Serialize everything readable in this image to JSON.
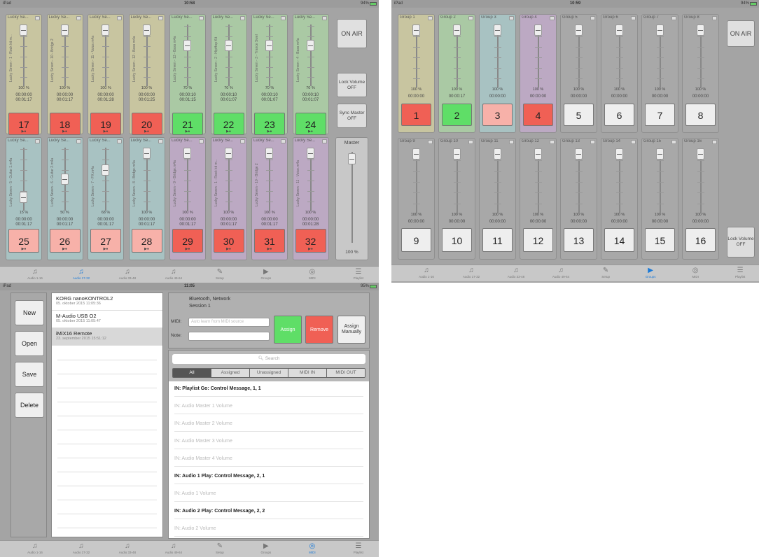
{
  "screen1": {
    "status": {
      "device": "iPad",
      "time": "10:58",
      "battery": "94%"
    },
    "row1": [
      {
        "name": "Lucky Se...",
        "track": "Lucky Seven - 1 - Rock kit m...",
        "color": "y",
        "pct": "100 %",
        "t1": "00:00:00",
        "t2": "00:01:17",
        "num": "17",
        "pad": "red"
      },
      {
        "name": "Lucky Se...",
        "track": "Lucky Seven - 10 - Bridge 2",
        "color": "y",
        "pct": "100 %",
        "t1": "00:00:00",
        "t2": "00:01:17",
        "num": "18",
        "pad": "red"
      },
      {
        "name": "Lucky Se...",
        "track": "Lucky Seven - 11 - Voice.m4a",
        "color": "y",
        "pct": "100 %",
        "t1": "00:00:00",
        "t2": "00:01:28",
        "num": "19",
        "pad": "red"
      },
      {
        "name": "Lucky Se...",
        "track": "Lucky Seven - 12 - Bass m4a",
        "color": "y",
        "pct": "100 %",
        "t1": "00:00:00",
        "t2": "00:01:25",
        "num": "20",
        "pad": "red"
      },
      {
        "name": "Lucky Se...",
        "track": "Lucky Seven - 13 - Bass m4a",
        "color": "g",
        "pct": "70 %",
        "t1": "00:00:10",
        "t2": "00:01:15",
        "num": "21",
        "pad": "grn"
      },
      {
        "name": "Lucky Se...",
        "track": "Lucky Seven - 2 - HipHop Kit",
        "color": "g",
        "pct": "70 %",
        "t1": "00:00:10",
        "t2": "00:01:07",
        "num": "22",
        "pad": "grn"
      },
      {
        "name": "Lucky Se...",
        "track": "Lucky Seven - 3 - Trance Swel",
        "color": "g",
        "pct": "70 %",
        "t1": "00:00:10",
        "t2": "00:01:07",
        "num": "23",
        "pad": "grn"
      },
      {
        "name": "Lucky Se...",
        "track": "Lucky Seven - 4 - Bass m4a",
        "color": "g",
        "pct": "70 %",
        "t1": "00:00:10",
        "t2": "00:01:07",
        "num": "24",
        "pad": "grn"
      }
    ],
    "row2": [
      {
        "name": "Lucky Se...",
        "track": "Lucky Seven - 5 - Guitar 1.m4a",
        "color": "t",
        "pct": "15 %",
        "t1": "00:00:00",
        "t2": "00:01:17",
        "num": "25",
        "pad": "pink"
      },
      {
        "name": "Lucky Se...",
        "track": "Lucky Seven - 6 - Guitar 2.m4a",
        "color": "t",
        "pct": "50 %",
        "t1": "00:00:00",
        "t2": "00:01:17",
        "num": "26",
        "pad": "pink"
      },
      {
        "name": "Lucky Se...",
        "track": "Lucky Seven - 7 - FX.m4a",
        "color": "t",
        "pct": "68 %",
        "t1": "00:00:00",
        "t2": "00:01:17",
        "num": "27",
        "pad": "pink"
      },
      {
        "name": "Lucky Se...",
        "track": "Lucky Seven - 8 - Bridge.m4a",
        "color": "t",
        "pct": "100 %",
        "t1": "00:00:00",
        "t2": "00:01:17",
        "num": "28",
        "pad": "pink"
      },
      {
        "name": "Lucky Se...",
        "track": "Lucky Seven - 9 - Bridge.m4a",
        "color": "p",
        "pct": "100 %",
        "t1": "00:00:00",
        "t2": "00:01:17",
        "num": "29",
        "pad": "red"
      },
      {
        "name": "Lucky Se...",
        "track": "Lucky Seven - 1 - Rock kit m...",
        "color": "p",
        "pct": "100 %",
        "t1": "00:00:00",
        "t2": "00:01:17",
        "num": "30",
        "pad": "red"
      },
      {
        "name": "Lucky Se...",
        "track": "Lucky Seven - 10 - Bridge 2",
        "color": "p",
        "pct": "100 %",
        "t1": "00:00:00",
        "t2": "00:01:17",
        "num": "31",
        "pad": "red"
      },
      {
        "name": "Lucky Se...",
        "track": "Lucky Seven - 11 - Voice.m4a",
        "color": "p",
        "pct": "100 %",
        "t1": "00:00:00",
        "t2": "00:01:28",
        "num": "32",
        "pad": "red"
      }
    ],
    "onair": "ON AIR",
    "lock": "Lock Volume OFF",
    "sync": "Sync Master OFF",
    "master": "Master",
    "master_pct": "100 %",
    "tabs": [
      "Audio 1-16",
      "Audio 17-32",
      "Audio 33-48",
      "Audio 49-64",
      "Setup",
      "Groups",
      "MIDI",
      "Playlist"
    ]
  },
  "screen2": {
    "status": {
      "device": "iPad",
      "time": "10:59",
      "battery": "94%"
    },
    "groups": [
      {
        "name": "Group 1",
        "color": "y",
        "pct": "100 %",
        "t": "00:00:00",
        "num": "1",
        "pad": "red"
      },
      {
        "name": "Group 2",
        "color": "g",
        "pct": "100 %",
        "t": "00:00:17",
        "num": "2",
        "pad": "grn"
      },
      {
        "name": "Group 3",
        "color": "t",
        "pct": "100 %",
        "t": "00:00:00",
        "num": "3",
        "pad": "pink"
      },
      {
        "name": "Group 4",
        "color": "p",
        "pct": "100 %",
        "t": "00:00:00",
        "num": "4",
        "pad": "red"
      },
      {
        "name": "Group 5",
        "color": "x",
        "pct": "100 %",
        "t": "00:00:00",
        "num": "5",
        "pad": "lite"
      },
      {
        "name": "Group 6",
        "color": "x",
        "pct": "100 %",
        "t": "00:00:00",
        "num": "6",
        "pad": "lite"
      },
      {
        "name": "Group 7",
        "color": "x",
        "pct": "100 %",
        "t": "00:00:00",
        "num": "7",
        "pad": "lite"
      },
      {
        "name": "Group 8",
        "color": "x",
        "pct": "100 %",
        "t": "00:00:00",
        "num": "8",
        "pad": "lite"
      },
      {
        "name": "Group 9",
        "color": "x",
        "pct": "100 %",
        "t": "00:00:00",
        "num": "9",
        "pad": "lite"
      },
      {
        "name": "Group 10",
        "color": "x",
        "pct": "100 %",
        "t": "00:00:00",
        "num": "10",
        "pad": "lite"
      },
      {
        "name": "Group 11",
        "color": "x",
        "pct": "100 %",
        "t": "00:00:00",
        "num": "11",
        "pad": "lite"
      },
      {
        "name": "Group 12",
        "color": "x",
        "pct": "100 %",
        "t": "00:00:00",
        "num": "12",
        "pad": "lite"
      },
      {
        "name": "Group 13",
        "color": "x",
        "pct": "100 %",
        "t": "00:00:00",
        "num": "13",
        "pad": "lite"
      },
      {
        "name": "Group 14",
        "color": "x",
        "pct": "100 %",
        "t": "00:00:00",
        "num": "14",
        "pad": "lite"
      },
      {
        "name": "Group 15",
        "color": "x",
        "pct": "100 %",
        "t": "00:00:00",
        "num": "15",
        "pad": "lite"
      },
      {
        "name": "Group 16",
        "color": "x",
        "pct": "100 %",
        "t": "00:00:00",
        "num": "16",
        "pad": "lite"
      }
    ],
    "onair": "ON AIR",
    "lock": "Lock Volume OFF",
    "tabs": [
      "Audio 1-16",
      "Audio 17-32",
      "Audio 33-48",
      "Audio 49-64",
      "Setup",
      "Groups",
      "MIDI",
      "Playlist"
    ]
  },
  "screen3": {
    "status": {
      "device": "iPad",
      "time": "11:05",
      "battery": "95%"
    },
    "buttons": [
      "New",
      "Open",
      "Save",
      "Delete"
    ],
    "devices": [
      {
        "title": "KORG nanoKONTROL2",
        "date": "05. oktober 2015 11:05:36"
      },
      {
        "title": "M-Audio USB O2",
        "date": "05. oktober 2015 11:05:47"
      },
      {
        "title": "iMiX16 Remote",
        "date": "23. september 2015 15:51:12"
      }
    ],
    "conn": "Bluetooth, Network",
    "session": "Session 1",
    "midi_label": "MIDI:",
    "midi_placeholder": "Auto learn from MIDI source",
    "note_label": "Note:",
    "assign": "Assign",
    "remove": "Remove",
    "assign_manually": "Assign Manually",
    "search": "Search",
    "filters": [
      "All",
      "Assigned",
      "Unassigned",
      "MIDI IN",
      "MIDI OUT"
    ],
    "messages": [
      {
        "text": "IN: Playlist Go: Control Message, 1, 1",
        "bold": true
      },
      {
        "text": "IN: Audio Master 1 Volume",
        "bold": false
      },
      {
        "text": "IN: Audio Master 2 Volume",
        "bold": false
      },
      {
        "text": "IN: Audio Master 3 Volume",
        "bold": false
      },
      {
        "text": "IN: Audio Master 4 Volume",
        "bold": false
      },
      {
        "text": "IN: Audio 1 Play: Control Message, 2, 1",
        "bold": true
      },
      {
        "text": "IN: Audio 1 Volume",
        "bold": false
      },
      {
        "text": "IN: Audio 2 Play: Control Message, 2, 2",
        "bold": true
      },
      {
        "text": "IN: Audio 2 Volume",
        "bold": false
      }
    ],
    "tabs": [
      "Audio 1-16",
      "Audio 17-32",
      "Audio 33-48",
      "Audio 49-64",
      "Setup",
      "Groups",
      "MIDI",
      "Playlist"
    ]
  },
  "colors": {
    "red": "#f06055",
    "green": "#5fde67",
    "pink": "#f7b1a9",
    "accent": "#1a7ad8"
  },
  "icons": {
    "audio": "music-note-icon",
    "setup": "edit-icon",
    "groups": "play-icon",
    "midi": "midi-icon",
    "playlist": "list-icon"
  }
}
